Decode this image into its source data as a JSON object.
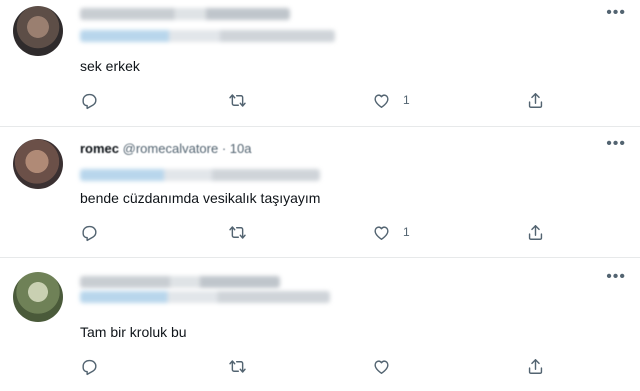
{
  "more_glyph": "•••",
  "tweets": [
    {
      "name": "",
      "handle": "",
      "time": "",
      "text": "sek erkek",
      "reply_count": "",
      "retweet_count": "",
      "like_count": "1"
    },
    {
      "name": "romec",
      "handle": "@romecalvatore",
      "time": "· 10a",
      "text": "bende cüzdanımda vesikalık taşıyayım",
      "reply_count": "",
      "retweet_count": "",
      "like_count": "1"
    },
    {
      "name": "",
      "handle": "",
      "time": "",
      "text": "Tam bir kroluk bu",
      "reply_count": "",
      "retweet_count": "",
      "like_count": ""
    }
  ],
  "icons": {
    "reply": "reply-icon",
    "retweet": "retweet-icon",
    "like": "like-icon",
    "share": "share-icon",
    "more": "more-icon"
  },
  "colors": {
    "icon": "#536471",
    "text": "#0f1419",
    "divider": "#e7e9ea"
  }
}
